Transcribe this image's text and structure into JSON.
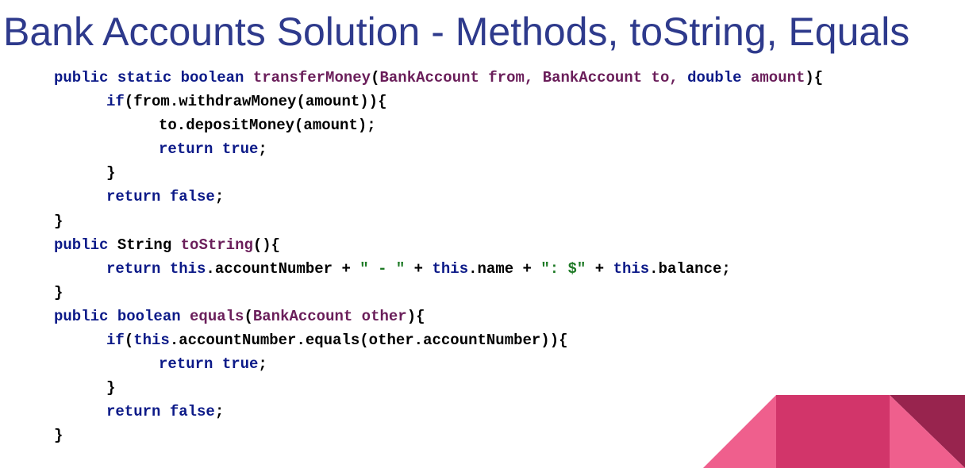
{
  "slide": {
    "title": "Bank Accounts Solution - Methods, toString, Equals"
  },
  "code": {
    "lines": [
      {
        "indent": 0,
        "tokens": [
          {
            "t": "kw",
            "v": "public static boolean "
          },
          {
            "t": "fn",
            "v": "transferMoney"
          },
          {
            "t": "text",
            "v": "("
          },
          {
            "t": "fn",
            "v": "BankAccount from, BankAccount to, "
          },
          {
            "t": "kw",
            "v": "double "
          },
          {
            "t": "fn",
            "v": "amount"
          },
          {
            "t": "text",
            "v": "){"
          }
        ]
      },
      {
        "indent": 1,
        "tokens": [
          {
            "t": "kw",
            "v": "if"
          },
          {
            "t": "text",
            "v": "(from.withdrawMoney(amount)){"
          }
        ]
      },
      {
        "indent": 2,
        "tokens": [
          {
            "t": "text",
            "v": "to.depositMoney(amount);"
          }
        ]
      },
      {
        "indent": 2,
        "tokens": [
          {
            "t": "kw",
            "v": "return true"
          },
          {
            "t": "text",
            "v": ";"
          }
        ]
      },
      {
        "indent": 1,
        "tokens": [
          {
            "t": "text",
            "v": "}"
          }
        ]
      },
      {
        "indent": 1,
        "tokens": [
          {
            "t": "kw",
            "v": "return false"
          },
          {
            "t": "text",
            "v": ";"
          }
        ]
      },
      {
        "indent": 0,
        "tokens": [
          {
            "t": "text",
            "v": "}"
          }
        ]
      },
      {
        "indent": 0,
        "tokens": [
          {
            "t": "kw",
            "v": "public "
          },
          {
            "t": "text",
            "v": "String "
          },
          {
            "t": "fn",
            "v": "toString"
          },
          {
            "t": "text",
            "v": "(){"
          }
        ]
      },
      {
        "indent": 1,
        "tokens": [
          {
            "t": "kw",
            "v": "return this"
          },
          {
            "t": "text",
            "v": ".accountNumber + "
          },
          {
            "t": "str",
            "v": "\" - \""
          },
          {
            "t": "text",
            "v": " + "
          },
          {
            "t": "kw",
            "v": "this"
          },
          {
            "t": "text",
            "v": ".name + "
          },
          {
            "t": "str",
            "v": "\": $\""
          },
          {
            "t": "text",
            "v": " + "
          },
          {
            "t": "kw",
            "v": "this"
          },
          {
            "t": "text",
            "v": ".balance;"
          }
        ]
      },
      {
        "indent": 0,
        "tokens": [
          {
            "t": "text",
            "v": "}"
          }
        ]
      },
      {
        "indent": 0,
        "tokens": [
          {
            "t": "kw",
            "v": "public boolean "
          },
          {
            "t": "fn",
            "v": "equals"
          },
          {
            "t": "text",
            "v": "("
          },
          {
            "t": "fn",
            "v": "BankAccount other"
          },
          {
            "t": "text",
            "v": "){"
          }
        ]
      },
      {
        "indent": 1,
        "tokens": [
          {
            "t": "kw",
            "v": "if"
          },
          {
            "t": "text",
            "v": "("
          },
          {
            "t": "kw",
            "v": "this"
          },
          {
            "t": "text",
            "v": ".accountNumber.equals(other.accountNumber)){"
          }
        ]
      },
      {
        "indent": 2,
        "tokens": [
          {
            "t": "kw",
            "v": "return true"
          },
          {
            "t": "text",
            "v": ";"
          }
        ]
      },
      {
        "indent": 1,
        "tokens": [
          {
            "t": "text",
            "v": "}"
          }
        ]
      },
      {
        "indent": 1,
        "tokens": [
          {
            "t": "kw",
            "v": "return false"
          },
          {
            "t": "text",
            "v": ";"
          }
        ]
      },
      {
        "indent": 0,
        "tokens": [
          {
            "t": "text",
            "v": "}"
          }
        ]
      }
    ]
  },
  "colors": {
    "title": "#2e3a8c",
    "keyword": "#0c1a88",
    "identifier": "#6a1e5a",
    "string": "#1e7a26",
    "decoration_light": "#ef5f8d",
    "decoration_mid": "#d2356a",
    "decoration_dark": "#98244e"
  }
}
